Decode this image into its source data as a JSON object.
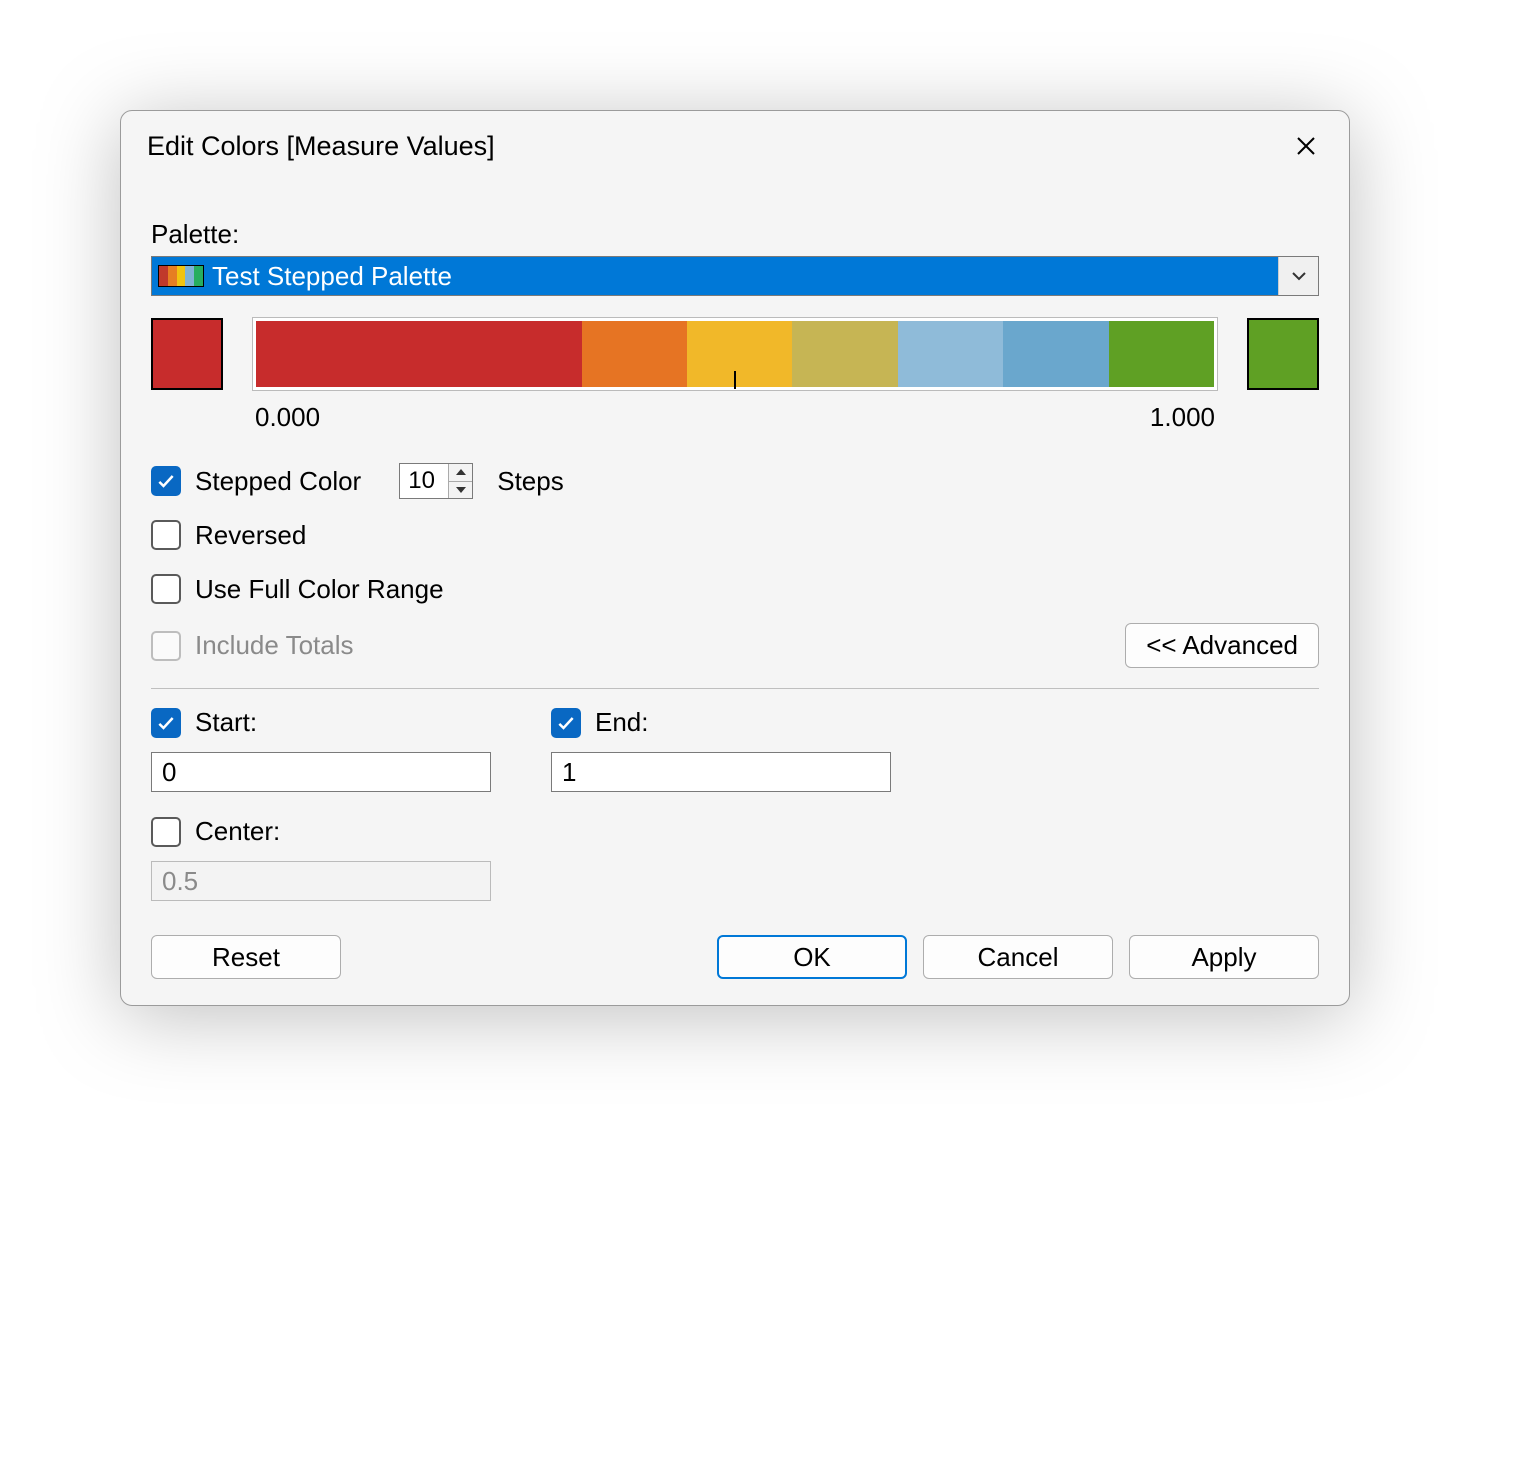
{
  "title": "Edit Colors [Measure Values]",
  "palette_label": "Palette:",
  "palette_selected": "Test Stepped Palette",
  "mini_swatch_colors": [
    "#c0392b",
    "#e67e22",
    "#f1c40f",
    "#7fb3d5",
    "#27ae60"
  ],
  "end_swatch_left": "#c72c2c",
  "end_swatch_right": "#5fa024",
  "gradient_steps": [
    {
      "color": "#c72c2c",
      "flex": 34
    },
    {
      "color": "#e67423",
      "flex": 11
    },
    {
      "color": "#f1b829",
      "flex": 11
    },
    {
      "color": "#c6b554",
      "flex": 11
    },
    {
      "color": "#8fbbd9",
      "flex": 11
    },
    {
      "color": "#6aa7cd",
      "flex": 11
    },
    {
      "color": "#5fa024",
      "flex": 11
    }
  ],
  "scale_min": "0.000",
  "scale_max": "1.000",
  "opts": {
    "stepped_label": "Stepped Color",
    "stepped_checked": true,
    "steps_value": "10",
    "steps_suffix": "Steps",
    "reversed_label": "Reversed",
    "reversed_checked": false,
    "full_range_label": "Use Full Color Range",
    "full_range_checked": false,
    "include_totals_label": "Include Totals",
    "include_totals_disabled": true
  },
  "advanced_button": "<< Advanced",
  "range": {
    "start_label": "Start:",
    "start_checked": true,
    "start_value": "0",
    "end_label": "End:",
    "end_checked": true,
    "end_value": "1",
    "center_label": "Center:",
    "center_checked": false,
    "center_value": "0.5"
  },
  "buttons": {
    "reset": "Reset",
    "ok": "OK",
    "cancel": "Cancel",
    "apply": "Apply"
  }
}
